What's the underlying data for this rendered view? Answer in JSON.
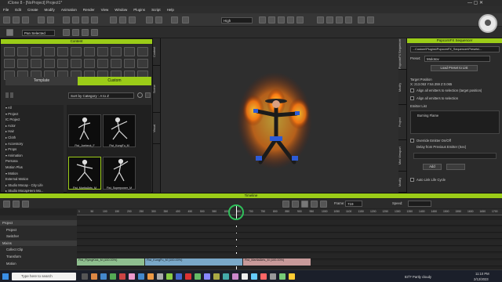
{
  "window": {
    "title": "iClone 8 - [NoProject] Project1*",
    "controls": "— ▢ ✕"
  },
  "menu": [
    "File",
    "Edit",
    "Create",
    "Modify",
    "Animation",
    "Render",
    "View",
    "Window",
    "Plugins",
    "Script",
    "Help"
  ],
  "toolbar": {
    "quality": "High",
    "mode": "Pan Selected",
    "logo_text": "ICLONE"
  },
  "content": {
    "title": "Content",
    "tabs": [
      "Template",
      "Custom"
    ],
    "sort_label": "Sort by Category : A to Z",
    "tree": [
      "▾ All",
      "  ▾ Project",
      "      IC Project",
      "  ▸ Actor",
      "  ▸ Hair",
      "  ▸ Cloth",
      "  ▸ Accessory",
      "  ▸ Props",
      "  ▾ Animation",
      "      Persona",
      "      Motion Plus",
      "  ▾ Motion",
      "      External Motion",
      "  ▸ Studio Mocap - City Life",
      "  ▸ Studio MocapHero Mo..."
    ],
    "thumbs": [
      {
        "label": "Fist_Joebeck_F"
      },
      {
        "label": "Fist_KungFu_M"
      },
      {
        "label": "Fist_MartialArts_M"
      },
      {
        "label": "Fist_Superpower_M"
      }
    ]
  },
  "left_vtabs": [
    "Content",
    "Scene",
    "Visual"
  ],
  "right_vtabs": [
    "PopcornFX Sequencer",
    "Modify",
    "Project",
    "Mini Viewport",
    "Modify"
  ],
  "sequencer": {
    "title": "PopcornFX Sequencer",
    "path": "...Custom\\Plugins\\PopcornFX_Sequencer\\Presets\\...",
    "preset_label": "Preset:",
    "preset_value": "Molotov",
    "load_button": "Load Preset to List",
    "target_label": "Target Position",
    "coords": "X: 213.053   Y:64.359   Z:0.065",
    "align_selected": "Align all emitters to selection (target position)",
    "align_selection": "Align all emitters to selection",
    "emitter_label": "Emitter List",
    "emitter_item": "Burning Flame",
    "override": "Override Emitter On/Off",
    "delay": "Delay from Previous Emitter (Sec)",
    "add": "Add",
    "auto_link": "Auto Link Life Cycle"
  },
  "timeline": {
    "title": "Timeline",
    "frame_label": "Frame:",
    "frame_value": "719",
    "speed_label": "Speed:",
    "ruler": [
      "1",
      "50",
      "100",
      "150",
      "200",
      "250",
      "300",
      "350",
      "400",
      "450",
      "500",
      "550",
      "600",
      "650",
      "700",
      "750",
      "800",
      "850",
      "900",
      "950",
      "1000",
      "1050",
      "1100",
      "1150",
      "1200",
      "1250",
      "1300",
      "1350",
      "1400",
      "1450",
      "1500",
      "1550",
      "1600",
      "1650",
      "1700"
    ],
    "rows": [
      {
        "label": "Project",
        "group": true
      },
      {
        "label": "Project",
        "group": false
      },
      {
        "label": "Switcher",
        "group": false
      },
      {
        "label": "Mixins",
        "group": true
      },
      {
        "label": "Collect Clip",
        "group": false
      },
      {
        "label": "Transform",
        "group": false
      },
      {
        "label": "Motion",
        "group": false
      }
    ],
    "clips": [
      {
        "label": "Fist_FlyingKick_M (100.00%)",
        "color": "#8fbf8f"
      },
      {
        "label": "Fist_KungFu_M (100.00%)",
        "color": "#7aa8c8"
      },
      {
        "label": "Fist_MartialArts_M (100.00%)",
        "color": "#c89a9a"
      }
    ]
  },
  "taskbar": {
    "search": "Type here to search",
    "weather": "83°F  Partly cloudy",
    "time": "11:10 PM",
    "date": "2/12/2023"
  },
  "colors": {
    "accent": "#9bcc18",
    "bg": "#1e1e1e",
    "panel": "#2a2a2a"
  }
}
